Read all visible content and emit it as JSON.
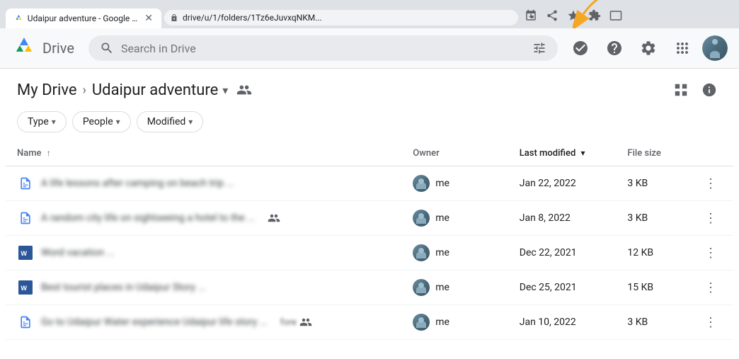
{
  "browser": {
    "url": "drive/u/1/folders/1Tz6eJuvxqNKM...",
    "tab_title": "Udaipur adventure - Google Drive",
    "icons": {
      "download": "⬇",
      "share": "↑",
      "star": "☆",
      "extension": "🧩",
      "tab_strip": "□"
    }
  },
  "header": {
    "search_placeholder": "Search in Drive",
    "filter_icon": "⚙",
    "settings_icon": "⚙",
    "help_icon": "?",
    "task_icon": "✓",
    "apps_icon": "⠿"
  },
  "breadcrumb": {
    "root": "My Drive",
    "separator": "›",
    "current": "Udaipur adventure",
    "dropdown_icon": "▾",
    "share_people_icon": "👤"
  },
  "filters": [
    {
      "label": "Type",
      "has_arrow": true
    },
    {
      "label": "People",
      "has_arrow": true
    },
    {
      "label": "Modified",
      "has_arrow": true
    }
  ],
  "toolbar": {
    "grid_view_icon": "⊞",
    "info_icon": "ⓘ"
  },
  "table": {
    "columns": {
      "name": "Name",
      "name_sort_icon": "↑",
      "owner": "Owner",
      "modified": "Last modified",
      "modified_sort_icon": "▾",
      "size": "File size"
    },
    "rows": [
      {
        "icon_type": "docs",
        "name": "A life lessons after camping on beach trip ...",
        "shared": false,
        "shared_badge": "",
        "owner": "me",
        "modified": "Jan 22, 2022",
        "size": "3 KB"
      },
      {
        "icon_type": "docs",
        "name": "A random city life on sightseeing a hotel to the ...",
        "shared": true,
        "shared_badge": "👥",
        "owner": "me",
        "modified": "Jan 8, 2022",
        "size": "3 KB"
      },
      {
        "icon_type": "word",
        "name": "Word vacation ...",
        "shared": false,
        "shared_badge": "",
        "owner": "me",
        "modified": "Dec 22, 2021",
        "size": "12 KB"
      },
      {
        "icon_type": "word",
        "name": "Best tourist places in Udaipur Story ...",
        "shared": false,
        "shared_badge": "",
        "owner": "me",
        "modified": "Dec 25, 2021",
        "size": "15 KB"
      },
      {
        "icon_type": "docs",
        "name": "Go to Udaipur Water experience Udaipur life story ...",
        "shared": true,
        "shared_badge": "fore 👥",
        "owner": "me",
        "modified": "Jan 10, 2022",
        "size": "3 KB"
      }
    ]
  }
}
